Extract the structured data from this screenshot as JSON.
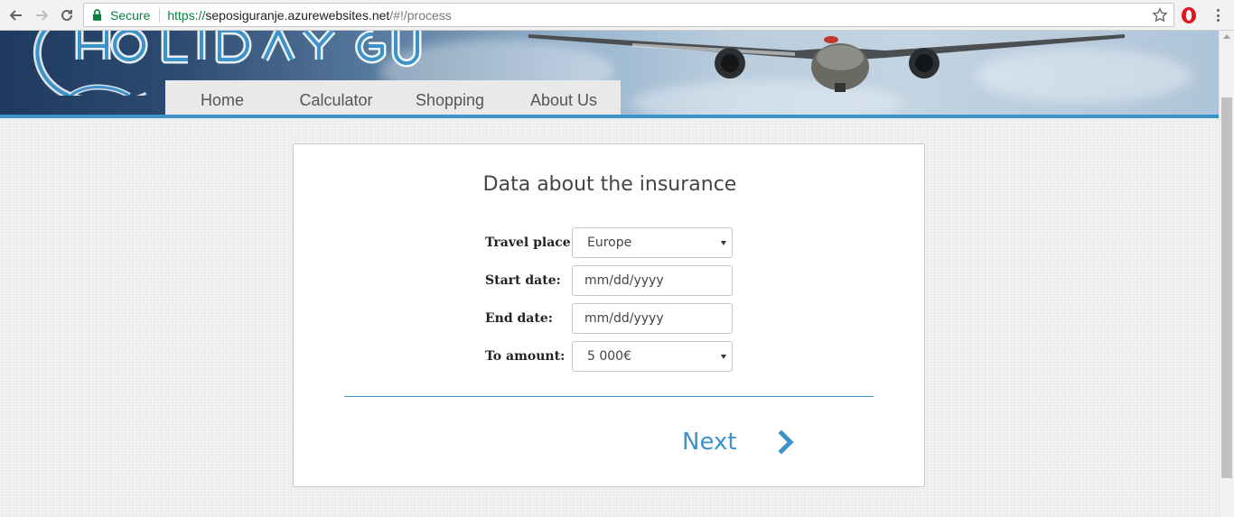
{
  "browser": {
    "secure_label": "Secure",
    "url_scheme": "https://",
    "url_host": "seposiguranje.azurewebsites.net",
    "url_path": "/#!/process"
  },
  "nav": {
    "items": [
      {
        "label": "Home"
      },
      {
        "label": "Calculator"
      },
      {
        "label": "Shopping"
      },
      {
        "label": "About Us"
      }
    ]
  },
  "form": {
    "title": "Data about the insurance",
    "travel_place": {
      "label": "Travel place:",
      "value": "Europe"
    },
    "start_date": {
      "label": "Start date:",
      "placeholder": "mm/dd/yyyy"
    },
    "end_date": {
      "label": "End date:",
      "placeholder": "mm/dd/yyyy"
    },
    "amount": {
      "label": "To amount:",
      "value": "5 000€"
    },
    "next_label": "Next"
  },
  "colors": {
    "accent": "#3c93c9",
    "secure_green": "#0b8043"
  }
}
